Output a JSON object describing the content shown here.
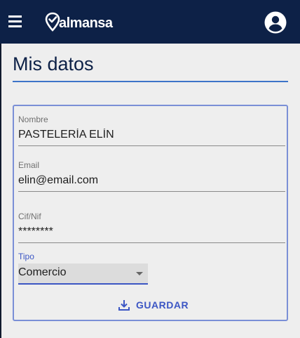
{
  "header": {
    "menu_icon": "menu-icon",
    "brand": "almansa",
    "account_icon": "account-circle-icon"
  },
  "page": {
    "title": "Mis datos"
  },
  "form": {
    "nombre": {
      "label": "Nombre",
      "value": "PASTELERÍA ELÍN"
    },
    "email": {
      "label": "Email",
      "value": "elin@email.com"
    },
    "cif": {
      "label": "Cif/Nif",
      "value": "********"
    },
    "tipo": {
      "label": "Tipo",
      "value": "Comercio"
    },
    "save": {
      "label": "GUARDAR",
      "icon": "download-icon"
    }
  },
  "colors": {
    "header_bg": "#0d2147",
    "accent": "#3c56c4",
    "card_border": "#7a8fd6",
    "background": "#eeeeee"
  }
}
